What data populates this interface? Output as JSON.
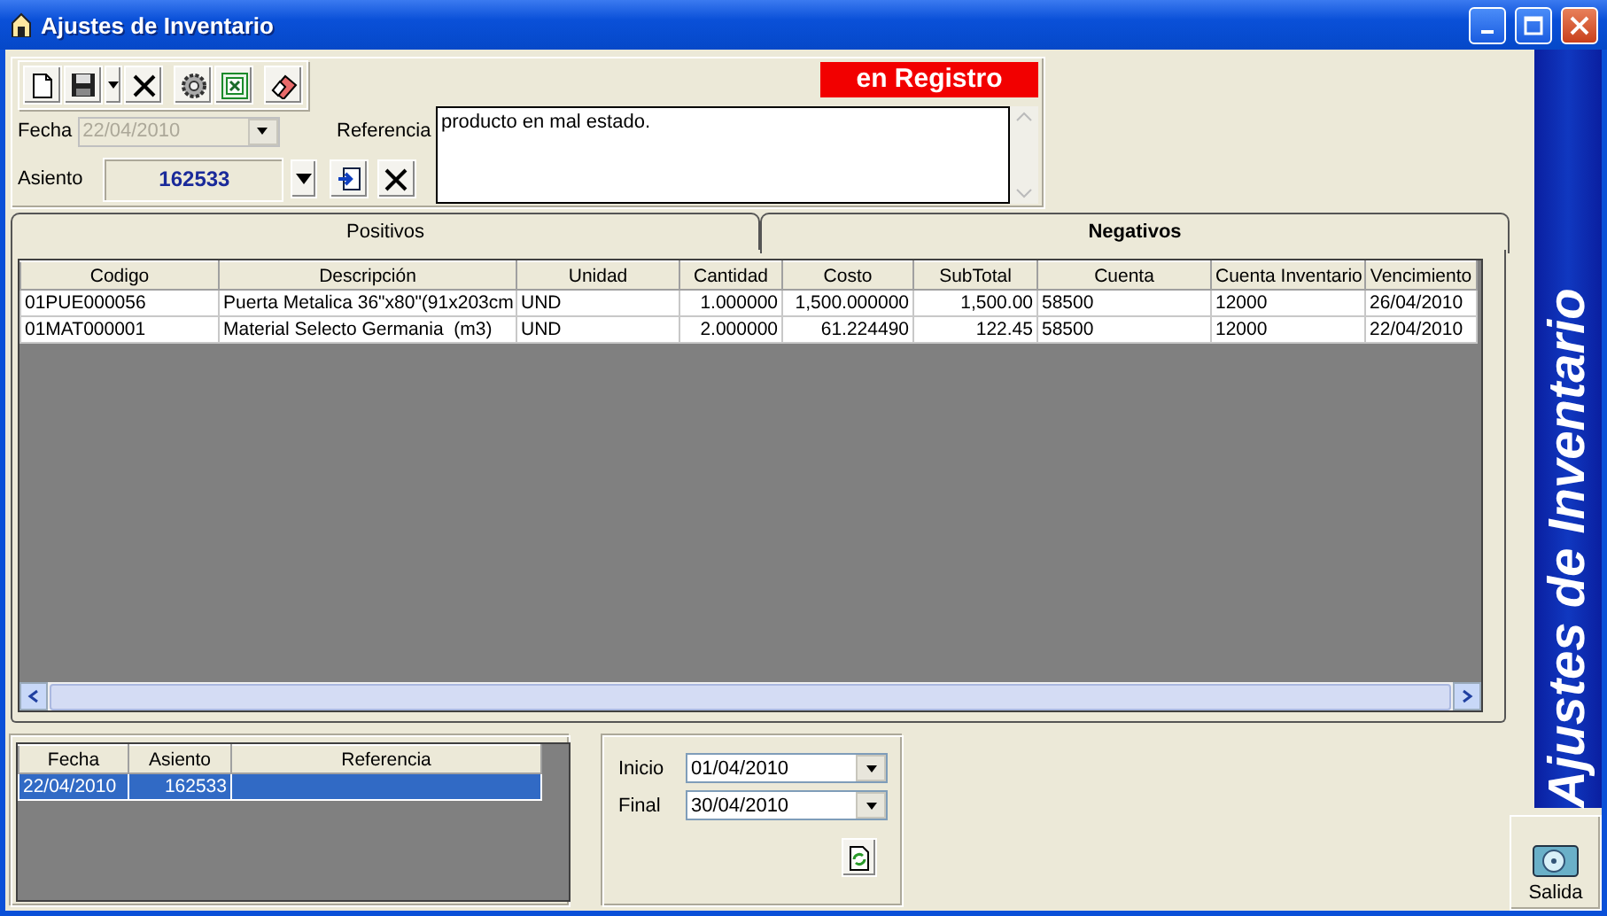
{
  "window": {
    "title": "Ajustes de Inventario"
  },
  "toolbar": [
    {
      "kind": "new"
    },
    {
      "kind": "save"
    },
    {
      "kind": "dropdown"
    },
    {
      "kind": "delete"
    },
    {
      "kind": "gear"
    },
    {
      "kind": "excel"
    },
    {
      "kind": "eraser"
    }
  ],
  "status": "en Registro",
  "fecha": {
    "label": "Fecha",
    "value": "22/04/2010",
    "disabled": true
  },
  "referencia": {
    "label": "Referencia",
    "value": "producto en mal estado."
  },
  "asiento": {
    "label": "Asiento",
    "value": "162533"
  },
  "tabs": [
    {
      "label": "Positivos",
      "selected": false
    },
    {
      "label": "Negativos",
      "selected": true
    }
  ],
  "table": {
    "columns": [
      "Codigo",
      "Descripción",
      "Unidad",
      "Cantidad",
      "Costo",
      "SubTotal",
      "Cuenta",
      "Cuenta Inventario",
      "Vencimiento"
    ],
    "rows": [
      [
        "01PUE000056",
        "Puerta Metalica 36\"x80\"(91x203cm",
        "UND",
        "1.000000",
        "1,500.000000",
        "1,500.00",
        "58500",
        "12000",
        "26/04/2010"
      ],
      [
        "01MAT000001",
        "Material Selecto Germania  (m3)",
        "UND",
        "2.000000",
        "61.224490",
        "122.45",
        "58500",
        "12000",
        "22/04/2010"
      ]
    ]
  },
  "history": {
    "columns": [
      "Fecha",
      "Asiento",
      "Referencia"
    ],
    "rows": [
      {
        "cells": [
          "22/04/2010",
          "162533"
        ],
        "selected": true
      }
    ]
  },
  "range": [
    {
      "label": "Inicio",
      "value": "01/04/2010"
    },
    {
      "label": "Final",
      "value": "30/04/2010"
    }
  ],
  "side_banner": "Ajustes de Inventario",
  "exit_button": {
    "label": "Salida"
  }
}
